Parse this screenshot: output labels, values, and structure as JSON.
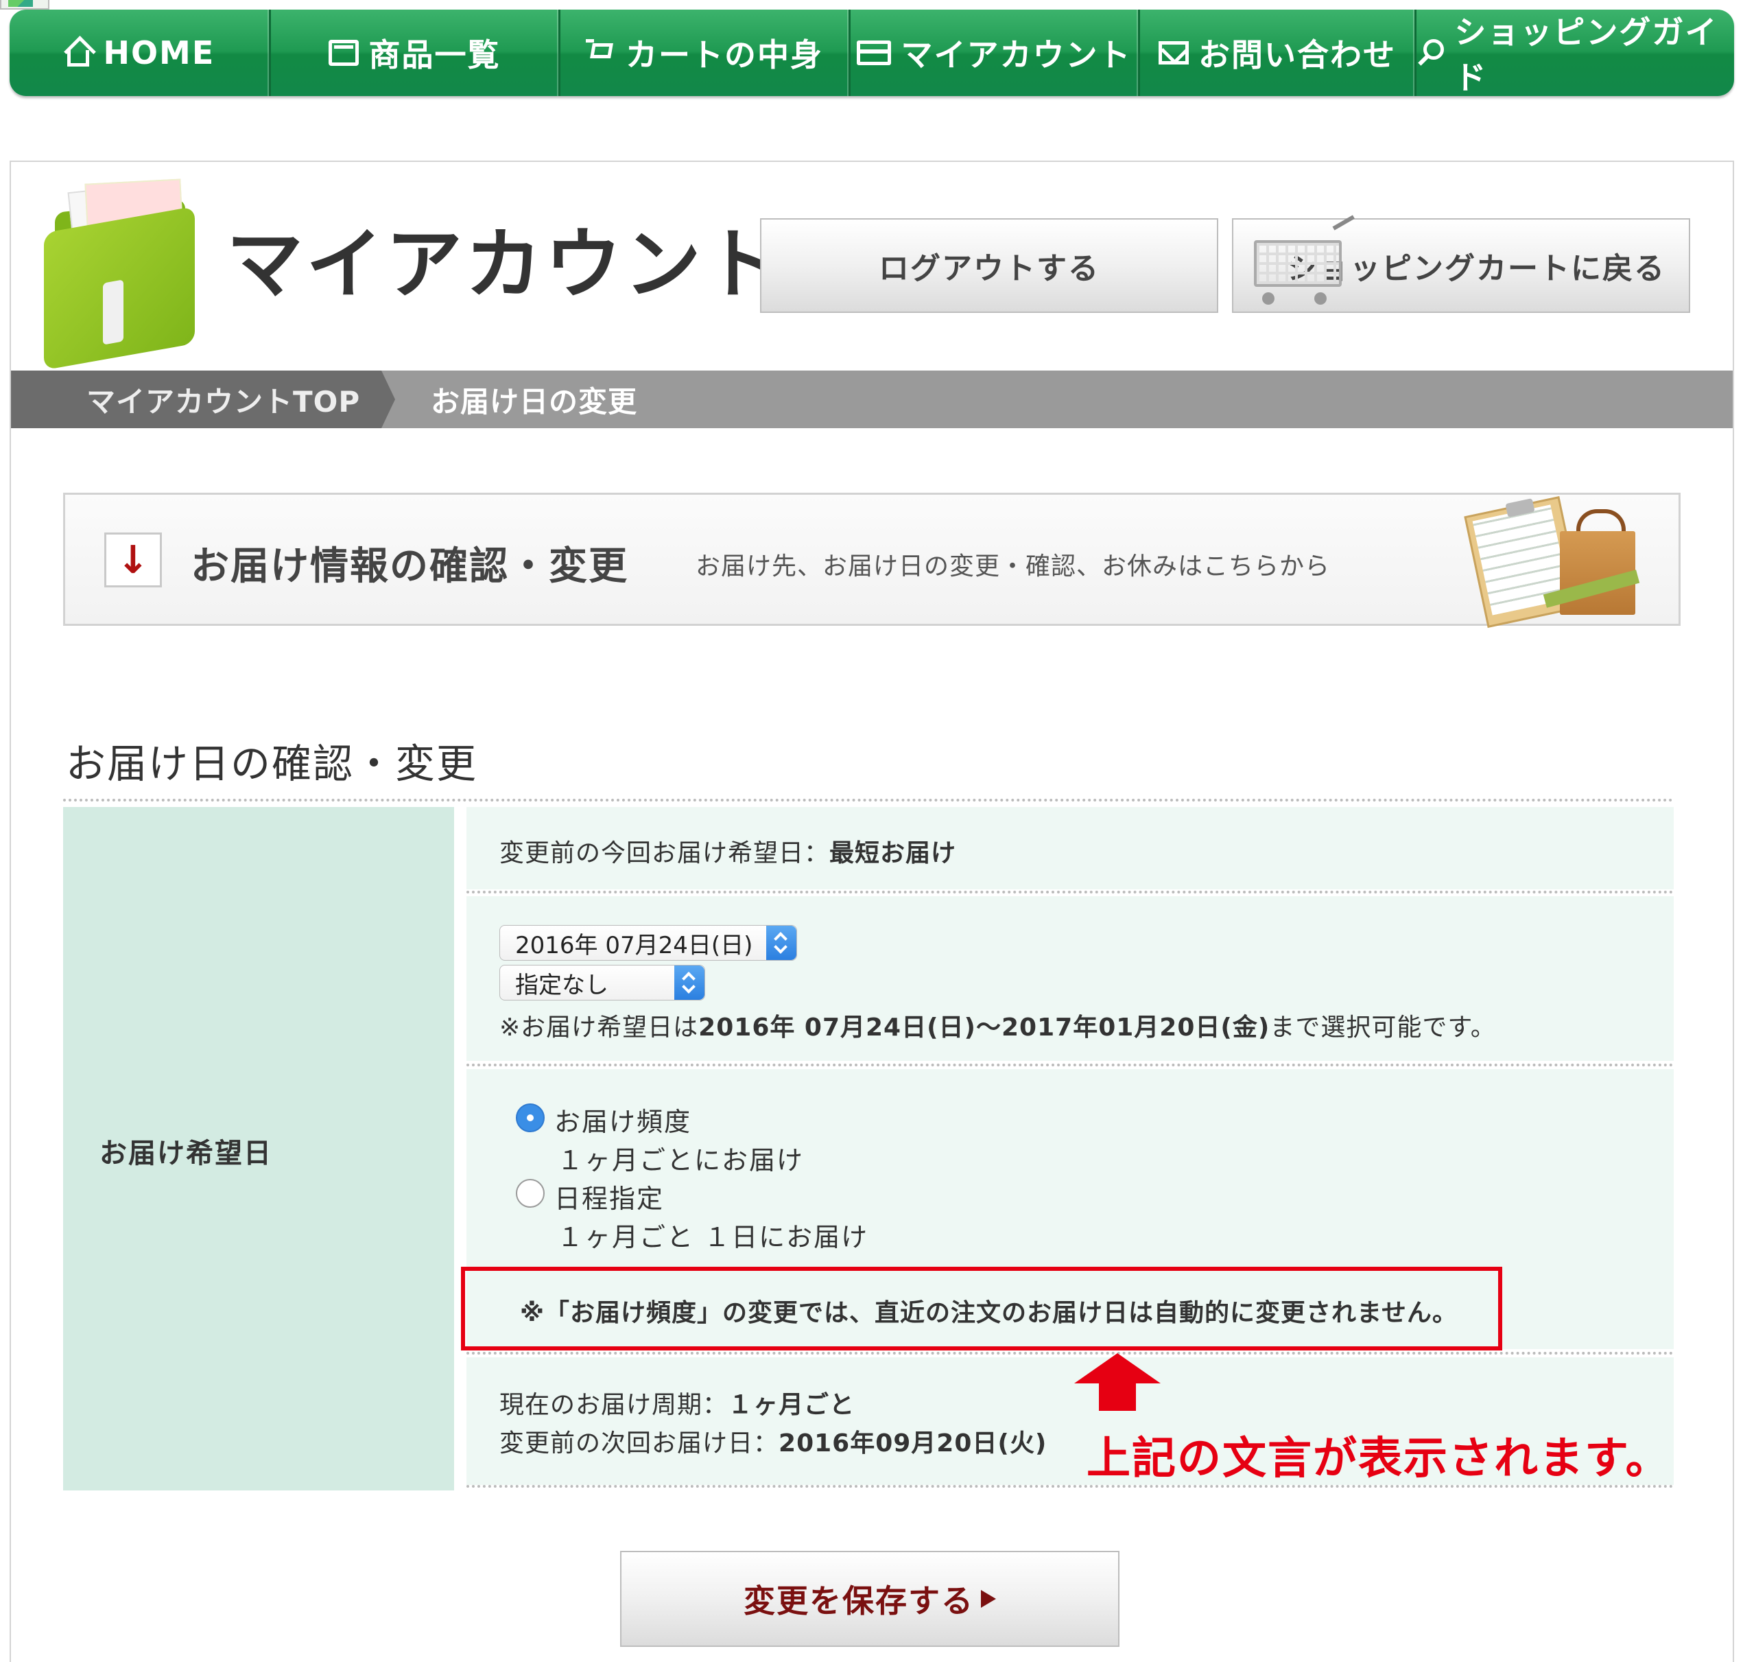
{
  "nav": {
    "items": [
      {
        "label": "HOME",
        "icon": "home-icon"
      },
      {
        "label": "商品一覧",
        "icon": "list-icon"
      },
      {
        "label": "カートの中身",
        "icon": "cart-icon"
      },
      {
        "label": "マイアカウント",
        "icon": "card-icon"
      },
      {
        "label": "お問い合わせ",
        "icon": "mail-icon"
      },
      {
        "label": "ショッピングガイド",
        "icon": "search-icon"
      }
    ]
  },
  "header": {
    "title": "マイアカウント",
    "logout_label": "ログアウトする",
    "back_to_cart_label": "ショッピングカートに戻る"
  },
  "breadcrumb": {
    "top": "マイアカウントTOP",
    "current": "お届け日の変更"
  },
  "banner": {
    "title": "お届け情報の確認・変更",
    "subtitle": "お届け先、お届け日の変更・確認、お休みはこちらから"
  },
  "form": {
    "heading": "お届け日の確認・変更",
    "label": "お届け希望日",
    "prev_date_label": "変更前の今回お届け希望日：",
    "prev_date_value": "最短お届け",
    "date_select_value": "2016年 07月24日(日)",
    "time_select_value": "指定なし",
    "date_note_prefix": "※お届け希望日は",
    "date_note_range": "2016年 07月24日(日)〜2017年01月20日(金)",
    "date_note_suffix": "まで選択可能です。",
    "option_frequency_label": "お届け頻度",
    "option_frequency_detail": "１ヶ月ごとにお届け",
    "option_date_label": "日程指定",
    "option_date_detail": "１ヶ月ごと １日にお届け",
    "notice": "※「お届け頻度」の変更では、直近の注文のお届け日は自動的に変更されません。",
    "cycle_label": "現在のお届け周期：",
    "cycle_value": "１ヶ月ごと",
    "next_label": "変更前の次回お届け日：",
    "next_value": "2016年09月20日(火)",
    "save_label": "変更を保存する"
  },
  "annotation": {
    "text": "上記の文言が表示されます。"
  },
  "colors": {
    "nav_green": "#1f9a52",
    "label_cell": "#d3ebe2",
    "value_cell": "#eef8f4",
    "highlight_red": "#e60012"
  }
}
